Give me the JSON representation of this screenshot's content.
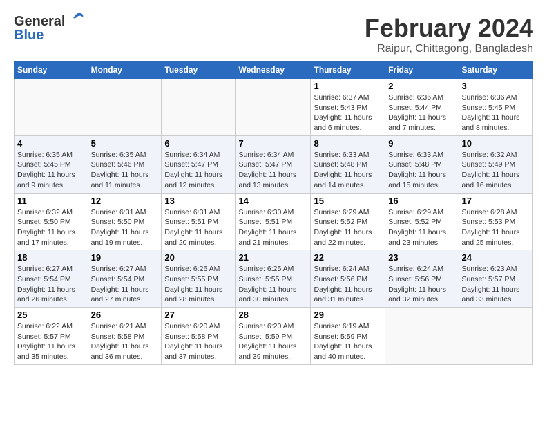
{
  "logo": {
    "line1": "General",
    "line2": "Blue"
  },
  "title": "February 2024",
  "location": "Raipur, Chittagong, Bangladesh",
  "weekdays": [
    "Sunday",
    "Monday",
    "Tuesday",
    "Wednesday",
    "Thursday",
    "Friday",
    "Saturday"
  ],
  "weeks": [
    [
      {
        "day": "",
        "info": ""
      },
      {
        "day": "",
        "info": ""
      },
      {
        "day": "",
        "info": ""
      },
      {
        "day": "",
        "info": ""
      },
      {
        "day": "1",
        "info": "Sunrise: 6:37 AM\nSunset: 5:43 PM\nDaylight: 11 hours\nand 6 minutes."
      },
      {
        "day": "2",
        "info": "Sunrise: 6:36 AM\nSunset: 5:44 PM\nDaylight: 11 hours\nand 7 minutes."
      },
      {
        "day": "3",
        "info": "Sunrise: 6:36 AM\nSunset: 5:45 PM\nDaylight: 11 hours\nand 8 minutes."
      }
    ],
    [
      {
        "day": "4",
        "info": "Sunrise: 6:35 AM\nSunset: 5:45 PM\nDaylight: 11 hours\nand 9 minutes."
      },
      {
        "day": "5",
        "info": "Sunrise: 6:35 AM\nSunset: 5:46 PM\nDaylight: 11 hours\nand 11 minutes."
      },
      {
        "day": "6",
        "info": "Sunrise: 6:34 AM\nSunset: 5:47 PM\nDaylight: 11 hours\nand 12 minutes."
      },
      {
        "day": "7",
        "info": "Sunrise: 6:34 AM\nSunset: 5:47 PM\nDaylight: 11 hours\nand 13 minutes."
      },
      {
        "day": "8",
        "info": "Sunrise: 6:33 AM\nSunset: 5:48 PM\nDaylight: 11 hours\nand 14 minutes."
      },
      {
        "day": "9",
        "info": "Sunrise: 6:33 AM\nSunset: 5:48 PM\nDaylight: 11 hours\nand 15 minutes."
      },
      {
        "day": "10",
        "info": "Sunrise: 6:32 AM\nSunset: 5:49 PM\nDaylight: 11 hours\nand 16 minutes."
      }
    ],
    [
      {
        "day": "11",
        "info": "Sunrise: 6:32 AM\nSunset: 5:50 PM\nDaylight: 11 hours\nand 17 minutes."
      },
      {
        "day": "12",
        "info": "Sunrise: 6:31 AM\nSunset: 5:50 PM\nDaylight: 11 hours\nand 19 minutes."
      },
      {
        "day": "13",
        "info": "Sunrise: 6:31 AM\nSunset: 5:51 PM\nDaylight: 11 hours\nand 20 minutes."
      },
      {
        "day": "14",
        "info": "Sunrise: 6:30 AM\nSunset: 5:51 PM\nDaylight: 11 hours\nand 21 minutes."
      },
      {
        "day": "15",
        "info": "Sunrise: 6:29 AM\nSunset: 5:52 PM\nDaylight: 11 hours\nand 22 minutes."
      },
      {
        "day": "16",
        "info": "Sunrise: 6:29 AM\nSunset: 5:52 PM\nDaylight: 11 hours\nand 23 minutes."
      },
      {
        "day": "17",
        "info": "Sunrise: 6:28 AM\nSunset: 5:53 PM\nDaylight: 11 hours\nand 25 minutes."
      }
    ],
    [
      {
        "day": "18",
        "info": "Sunrise: 6:27 AM\nSunset: 5:54 PM\nDaylight: 11 hours\nand 26 minutes."
      },
      {
        "day": "19",
        "info": "Sunrise: 6:27 AM\nSunset: 5:54 PM\nDaylight: 11 hours\nand 27 minutes."
      },
      {
        "day": "20",
        "info": "Sunrise: 6:26 AM\nSunset: 5:55 PM\nDaylight: 11 hours\nand 28 minutes."
      },
      {
        "day": "21",
        "info": "Sunrise: 6:25 AM\nSunset: 5:55 PM\nDaylight: 11 hours\nand 30 minutes."
      },
      {
        "day": "22",
        "info": "Sunrise: 6:24 AM\nSunset: 5:56 PM\nDaylight: 11 hours\nand 31 minutes."
      },
      {
        "day": "23",
        "info": "Sunrise: 6:24 AM\nSunset: 5:56 PM\nDaylight: 11 hours\nand 32 minutes."
      },
      {
        "day": "24",
        "info": "Sunrise: 6:23 AM\nSunset: 5:57 PM\nDaylight: 11 hours\nand 33 minutes."
      }
    ],
    [
      {
        "day": "25",
        "info": "Sunrise: 6:22 AM\nSunset: 5:57 PM\nDaylight: 11 hours\nand 35 minutes."
      },
      {
        "day": "26",
        "info": "Sunrise: 6:21 AM\nSunset: 5:58 PM\nDaylight: 11 hours\nand 36 minutes."
      },
      {
        "day": "27",
        "info": "Sunrise: 6:20 AM\nSunset: 5:58 PM\nDaylight: 11 hours\nand 37 minutes."
      },
      {
        "day": "28",
        "info": "Sunrise: 6:20 AM\nSunset: 5:59 PM\nDaylight: 11 hours\nand 39 minutes."
      },
      {
        "day": "29",
        "info": "Sunrise: 6:19 AM\nSunset: 5:59 PM\nDaylight: 11 hours\nand 40 minutes."
      },
      {
        "day": "",
        "info": ""
      },
      {
        "day": "",
        "info": ""
      }
    ]
  ]
}
